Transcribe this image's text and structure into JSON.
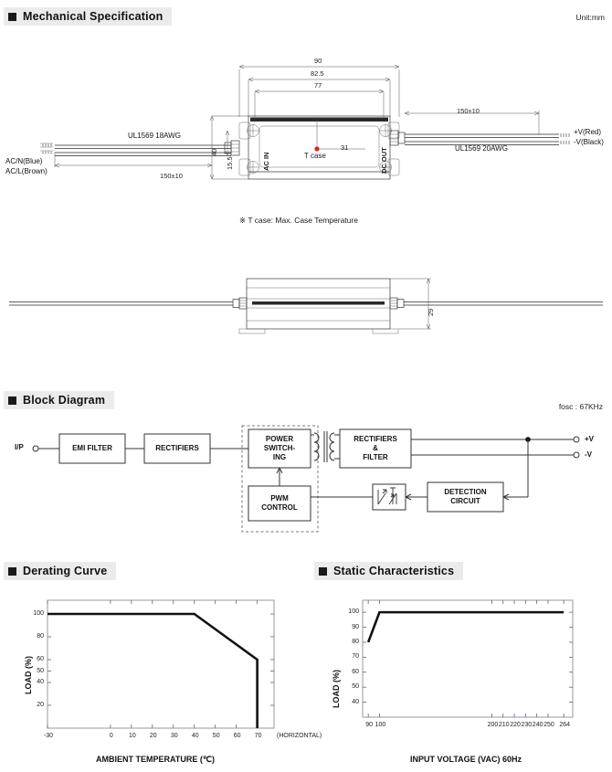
{
  "sections": {
    "mechanical": {
      "title": "Mechanical Specification",
      "unit": "Unit:mm"
    },
    "block": {
      "title": "Block Diagram",
      "fosc": "fosc : 67KHz"
    },
    "derating": {
      "title": "Derating Curve"
    },
    "static": {
      "title": "Static Characteristics"
    }
  },
  "mechanical": {
    "dimensions": {
      "overall_width": "90",
      "mount_width": "82.5",
      "case_width": "77",
      "height_total": "40",
      "height_mount": "15.5",
      "case_center": "31",
      "side_height": "29",
      "wire_len_in": "150±10",
      "wire_len_out": "150±10"
    },
    "labels": {
      "ac_in": "AC IN",
      "dc_out": "DC OUT",
      "t_case": "T case",
      "input_wire_spec": "UL1569 18AWG",
      "output_wire_spec": "UL1569 20AWG",
      "acn": "AC/N(Blue)",
      "acl": "AC/L(Brown)",
      "vplus": "+V(Red)",
      "vminus": "-V(Black)"
    },
    "footnote": "※ T case: Max. Case Temperature",
    "tcase_marker_color": "#e02020"
  },
  "block_diagram": {
    "input_label": "I/P",
    "blocks": [
      {
        "id": "emi",
        "label": "EMI FILTER"
      },
      {
        "id": "rect1",
        "label": "RECTIFIERS"
      },
      {
        "id": "power",
        "label": "POWER\nSWITCH-\nING",
        "lines": [
          "POWER",
          "SWITCH-",
          "ING"
        ]
      },
      {
        "id": "pwm",
        "label": "PWM\nCONTROL",
        "lines": [
          "PWM",
          "CONTROL"
        ]
      },
      {
        "id": "rect2",
        "label": "RECTIFIERS\n&\nFILTER",
        "lines": [
          "RECTIFIERS",
          "&",
          "FILTER"
        ]
      },
      {
        "id": "detect",
        "label": "DETECTION\nCIRCUIT",
        "lines": [
          "DETECTION",
          "CIRCUIT"
        ]
      }
    ],
    "outputs": [
      {
        "label": "+V"
      },
      {
        "label": "-V"
      }
    ]
  },
  "chart_data": [
    {
      "type": "line",
      "id": "derating-curve",
      "title": "Derating Curve",
      "xlabel": "AMBIENT TEMPERATURE (℃)",
      "ylabel": "LOAD (%)",
      "xlim": [
        -30,
        78
      ],
      "ylim": [
        0,
        112
      ],
      "xticks": [
        -30,
        0,
        10,
        20,
        30,
        40,
        50,
        60,
        70
      ],
      "xtick_labels": [
        "-30",
        "0",
        "10",
        "20",
        "30",
        "40",
        "50",
        "60",
        "70"
      ],
      "yticks": [
        20,
        40,
        50,
        60,
        80,
        100
      ],
      "ytick_labels": [
        "20",
        "40",
        "50",
        "60",
        "80",
        "100"
      ],
      "annotation": "(HORIZONTAL)",
      "grid": false,
      "series": [
        {
          "name": "load derating",
          "x": [
            -30,
            40,
            70,
            70
          ],
          "y": [
            100,
            100,
            60,
            0
          ]
        }
      ]
    },
    {
      "type": "line",
      "id": "static-characteristics",
      "title": "Static Characteristics",
      "xlabel": "INPUT VOLTAGE (VAC) 60Hz",
      "ylabel": "LOAD (%)",
      "xlim": [
        85,
        272
      ],
      "ylim": [
        30,
        108
      ],
      "xticks": [
        90,
        100,
        200,
        210,
        220,
        230,
        240,
        250,
        264
      ],
      "xtick_labels": [
        "90",
        "100",
        "200",
        "210",
        "220",
        "230",
        "240",
        "250",
        "264"
      ],
      "yticks": [
        40,
        50,
        60,
        70,
        80,
        90,
        100
      ],
      "ytick_labels": [
        "40",
        "50",
        "60",
        "70",
        "80",
        "90",
        "100"
      ],
      "grid": false,
      "series": [
        {
          "name": "load vs input voltage",
          "x": [
            90,
            100,
            264
          ],
          "y": [
            80,
            100,
            100
          ]
        }
      ]
    }
  ]
}
